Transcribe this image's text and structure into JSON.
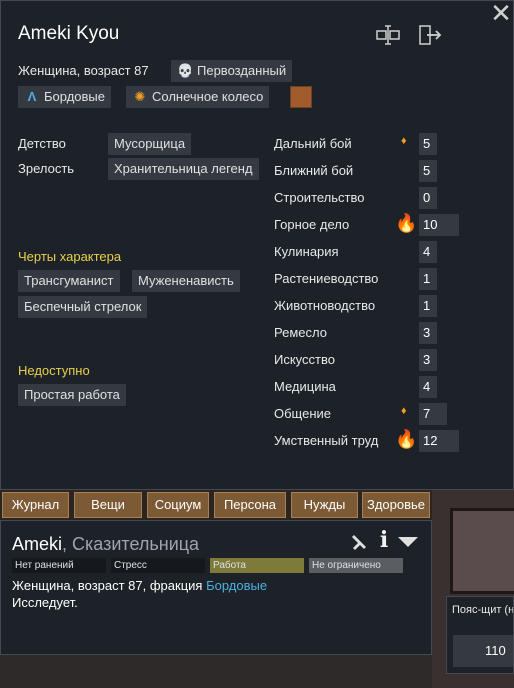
{
  "window": {
    "close_icon": "close-icon"
  },
  "header": {
    "name": "Ameki Kyou",
    "rename_icon": "rename-icon",
    "banish_icon": "banish-icon"
  },
  "identity": {
    "description": "Женщина, возраст 87",
    "xenotype": "Первозданный",
    "xenotype_icon": "skull-icon",
    "faction": "Бордовые",
    "faction_icon": "faction-a-icon",
    "ideology": "Солнечное колесо",
    "ideology_icon": "sun-wheel-icon",
    "favorite_color": "#a05c2c"
  },
  "backstory": {
    "childhood_label": "Детство",
    "childhood": "Мусорщица",
    "adulthood_label": "Зрелость",
    "adulthood": "Хранительница легенд"
  },
  "traits": {
    "title": "Черты характера",
    "items": [
      "Трансгуманист",
      "Мужененависть",
      "Беспечный стрелок"
    ]
  },
  "incapable": {
    "title": "Недоступно",
    "items": [
      "Простая работа"
    ]
  },
  "skills": [
    {
      "name": "Дальний бой",
      "value": "5",
      "passion": "minor"
    },
    {
      "name": "Ближний бой",
      "value": "5",
      "passion": "none"
    },
    {
      "name": "Строительство",
      "value": "0",
      "passion": "none"
    },
    {
      "name": "Горное дело",
      "value": "10",
      "passion": "major"
    },
    {
      "name": "Кулинария",
      "value": "4",
      "passion": "none"
    },
    {
      "name": "Растениеводство",
      "value": "1",
      "passion": "none"
    },
    {
      "name": "Животноводство",
      "value": "1",
      "passion": "none"
    },
    {
      "name": "Ремесло",
      "value": "3",
      "passion": "none"
    },
    {
      "name": "Искусство",
      "value": "3",
      "passion": "none"
    },
    {
      "name": "Медицина",
      "value": "4",
      "passion": "none"
    },
    {
      "name": "Общение",
      "value": "7",
      "passion": "minor"
    },
    {
      "name": "Умственный труд",
      "value": "12",
      "passion": "major"
    }
  ],
  "tabs": [
    "Журнал",
    "Вещи",
    "Социум",
    "Персона",
    "Нужды",
    "Здоровье"
  ],
  "inspector": {
    "name": "Ameki",
    "title_sep": ", ",
    "title": "Сказительница",
    "draft_icon": "draft-icon",
    "info_icon": "info-icon",
    "collapse_icon": "collapse-icon",
    "bars": {
      "health": "Нет ранений",
      "mood": "Стресс",
      "work": "Работа",
      "restriction": "Не ограничено"
    },
    "line1_prefix": "Женщина, возраст 87, фракция ",
    "line1_faction": "Бордовые",
    "line2": "Исследует."
  },
  "shield": {
    "label": "Пояс-щит (н",
    "value": "110"
  }
}
